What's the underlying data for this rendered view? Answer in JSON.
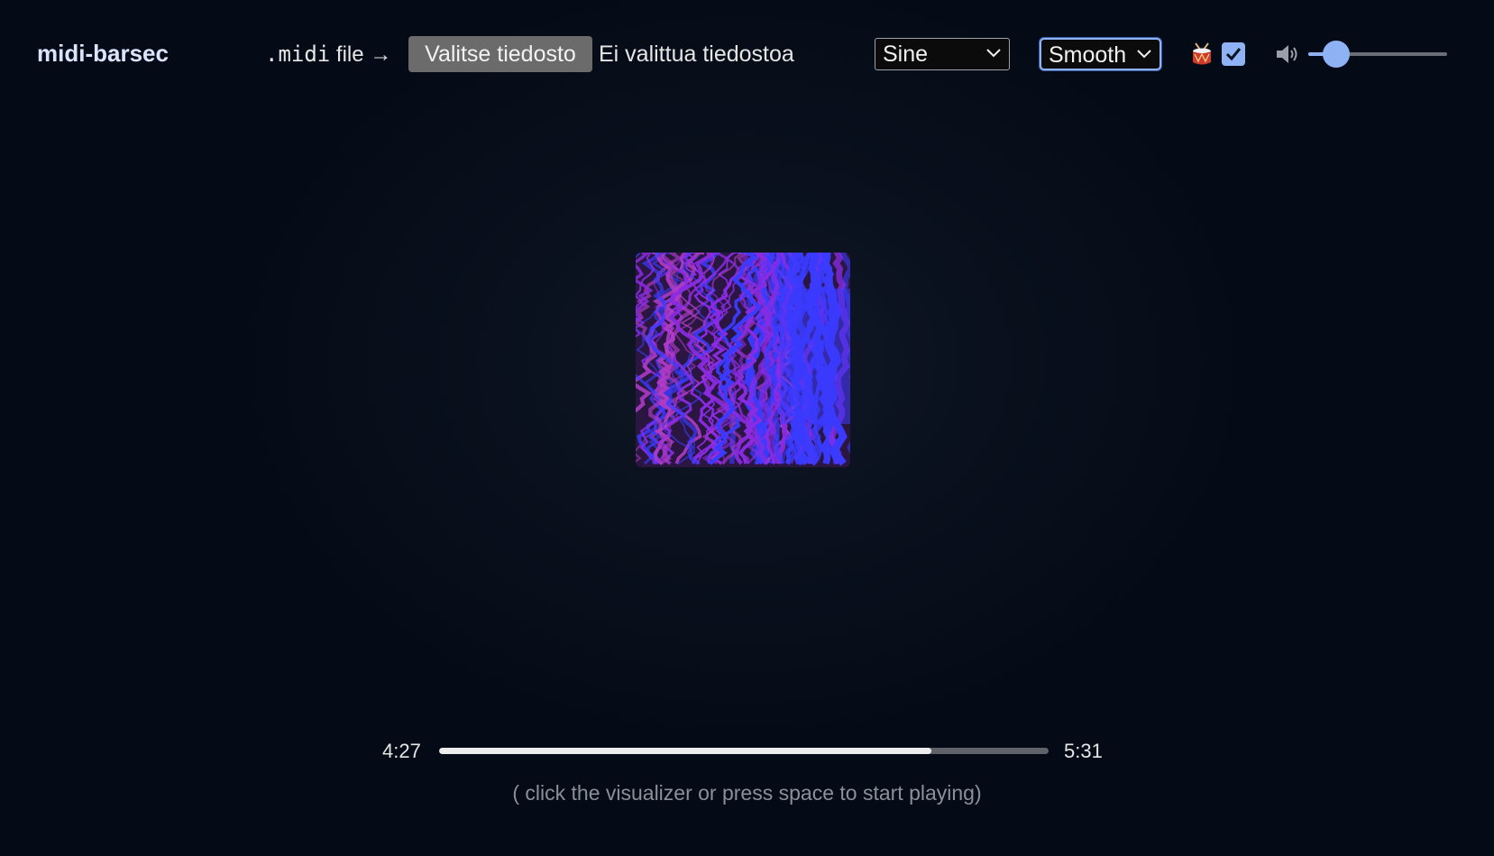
{
  "app": {
    "title": "midi-barsec"
  },
  "file_picker": {
    "label_code": ".midi",
    "label_text": "file →",
    "button_label": "Valitse tiedosto",
    "status": "Ei valittua tiedostoa"
  },
  "waveform_select": {
    "value": "Sine"
  },
  "mode_select": {
    "value": "Smooth"
  },
  "drums": {
    "icon": "drum-icon",
    "checked": true
  },
  "volume": {
    "icon": "speaker-icon",
    "value": 0.2
  },
  "visualizer": {
    "colors": [
      "#3b3bff",
      "#8a2be2",
      "#b03cc8",
      "#2a1640"
    ]
  },
  "playback": {
    "current_time": "4:27",
    "total_time": "5:31",
    "progress": 0.807
  },
  "hint": "( click the visualizer or press space to start playing)",
  "colors": {
    "accent": "#8fb2f5",
    "background": "#050b16",
    "title": "#dbe4ff"
  }
}
